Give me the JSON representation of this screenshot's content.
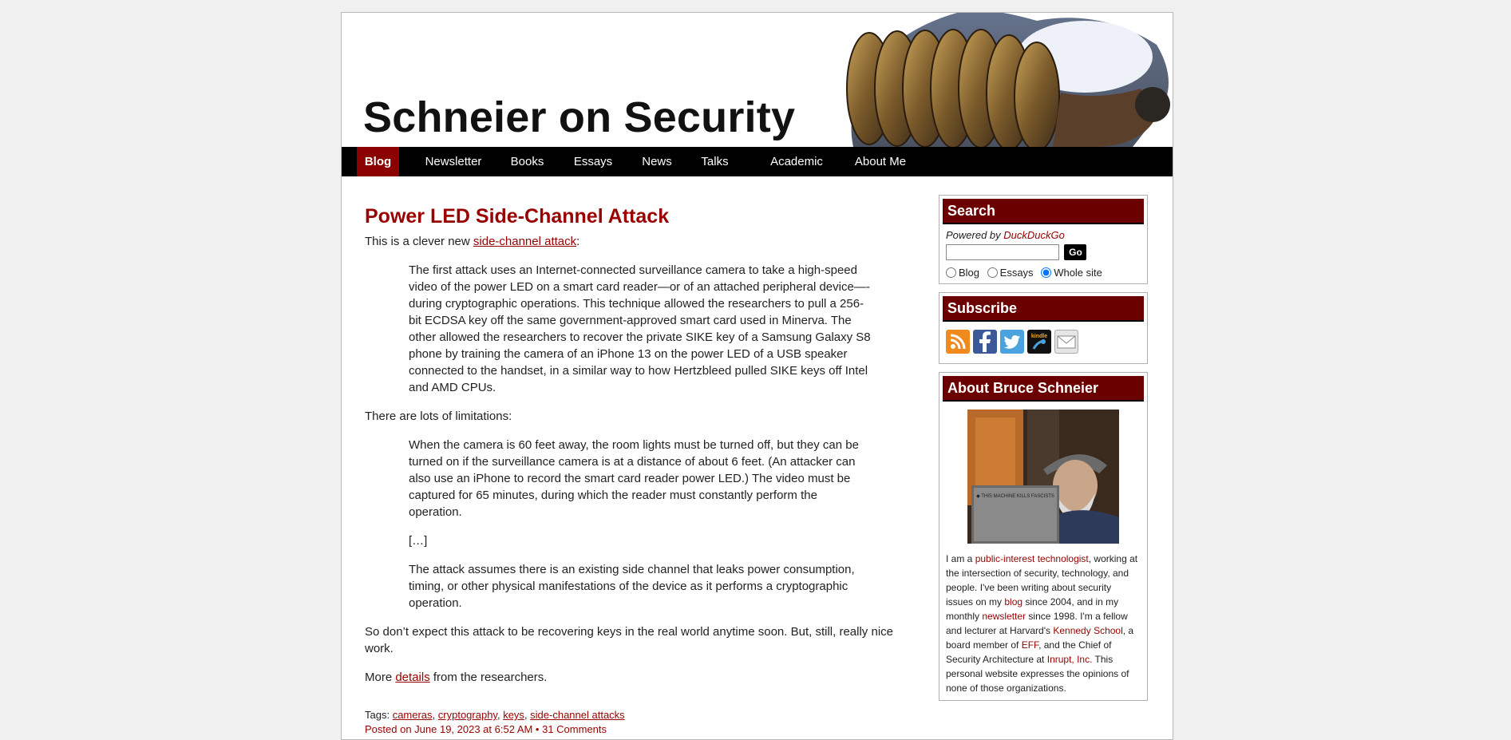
{
  "site": {
    "title": "Schneier on Security"
  },
  "nav": [
    {
      "label": "Blog",
      "active": true
    },
    {
      "label": "Newsletter"
    },
    {
      "label": "Books"
    },
    {
      "label": "Essays"
    },
    {
      "label": "News"
    },
    {
      "label": "Talks"
    },
    {
      "label": "Academic"
    },
    {
      "label": "About Me"
    }
  ],
  "post": {
    "title": "Power LED Side-Channel Attack",
    "intro_before": "This is a clever new ",
    "intro_link": "side-channel attack",
    "intro_after": ":",
    "quote1": "The first attack uses an Internet-connected surveillance camera to take a high-speed video of the power LED on a smart card reader—or of an attached peripheral device—-during cryptographic operations. This technique allowed the researchers to pull a 256-bit ECDSA key off the same government-approved smart card used in Minerva. The other allowed the researchers to recover the private SIKE key of a Samsung Galaxy S8 phone by training the camera of an iPhone 13 on the power LED of a USB speaker connected to the handset, in a similar way to how Hertzbleed pulled SIKE keys off Intel and AMD CPUs.",
    "limitations": "There are lots of limitations:",
    "quote2": "When the camera is 60 feet away, the room lights must be turned off, but they can be turned on if the surveillance camera is at a distance of about 6 feet. (An attacker can also use an iPhone to record the smart card reader power LED.) The video must be captured for 65 minutes, during which the reader must constantly perform the operation.",
    "ellipsis": "[…]",
    "quote3": "The attack assumes there is an existing side channel that leaks power consumption, timing, or other physical manifestations of the device as it performs a cryptographic operation.",
    "conclusion": "So don’t expect this attack to be recovering keys in the real world anytime soon. But, still, really nice work.",
    "more_before": "More ",
    "more_link": "details",
    "more_after": " from the researchers.",
    "tags_label": "Tags: ",
    "tags": [
      "cameras",
      "cryptography",
      "keys",
      "side-channel attacks"
    ],
    "posted": "Posted on June 19, 2023 at 6:52 AM • 31 Comments"
  },
  "sidebar": {
    "search": {
      "heading": "Search",
      "powered_prefix": "Powered by ",
      "powered_link": "DuckDuckGo",
      "input_value": "",
      "go_label": "Go",
      "options": [
        {
          "label": "Blog",
          "checked": false
        },
        {
          "label": "Essays",
          "checked": false
        },
        {
          "label": "Whole site",
          "checked": true
        }
      ]
    },
    "subscribe": {
      "heading": "Subscribe",
      "icons": [
        "rss-icon",
        "facebook-icon",
        "twitter-icon",
        "kindle-icon",
        "email-icon"
      ]
    },
    "about": {
      "heading": "About Bruce Schneier",
      "bio": [
        {
          "t": "I am a "
        },
        {
          "t": "public-interest technologist",
          "link": true
        },
        {
          "t": ", working at the intersection of security, technology, and people. I've been writing about security issues on my "
        },
        {
          "t": "blog",
          "link": true
        },
        {
          "t": " since 2004, and in my monthly "
        },
        {
          "t": "newsletter",
          "link": true
        },
        {
          "t": " since 1998. I'm a fellow and lecturer at Harvard's "
        },
        {
          "t": "Kennedy School",
          "link": true
        },
        {
          "t": ", a board member of "
        },
        {
          "t": "EFF",
          "link": true
        },
        {
          "t": ", and the Chief of Security Architecture at "
        },
        {
          "t": "Inrupt, Inc.",
          "link": true
        },
        {
          "t": " This personal website expresses the opinions of none of those organizations."
        }
      ]
    }
  },
  "colors": {
    "accent": "#990000",
    "nav_bg": "#000000",
    "widget_header": "#6b0000"
  }
}
